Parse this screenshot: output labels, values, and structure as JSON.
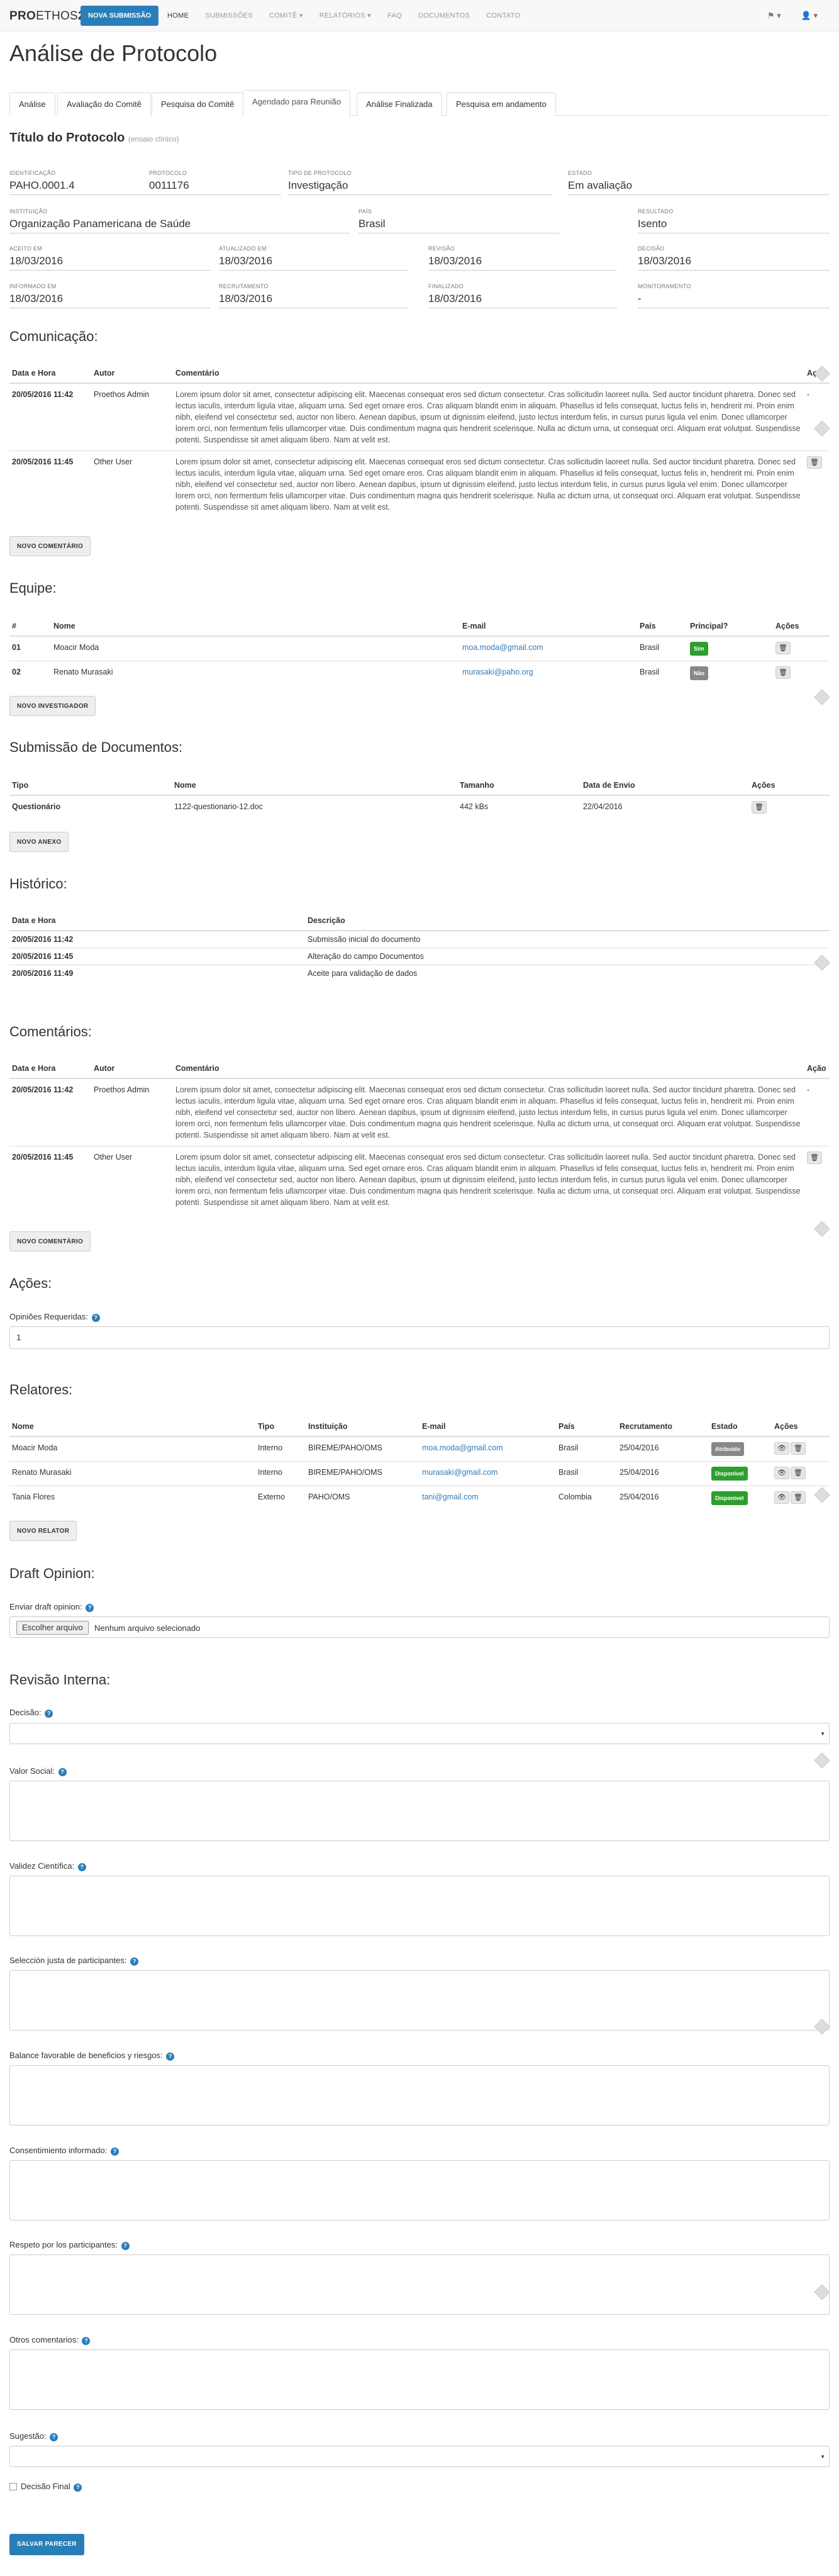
{
  "nav": {
    "brand_a": "PRO",
    "brand_b": "ETHOS",
    "brand_c": "2",
    "new_submission": "NOVA SUBMISSÃO",
    "items": [
      "HOME",
      "SUBMISSÕES",
      "COMITÊ ▾",
      "RELATÓRIOS ▾",
      "FAQ",
      "DOCUMENTOS",
      "CONTATO"
    ],
    "flag": "⚑ ▾",
    "user": "👤 ▾"
  },
  "page_title": "Análise de Protocolo",
  "tabs": [
    "Análise",
    "Avaliação do Comitê",
    "Pesquisa do Comitê",
    "Agendado para Reunião",
    "Análise Finalizada",
    "Pesquisa em andamento"
  ],
  "protocol": {
    "title": "Título do Protocolo",
    "subtitle": "(ensaio clínico)",
    "fields": [
      {
        "label": "IDENTIFICAÇÃO",
        "value": "PAHO.0001.4"
      },
      {
        "label": "PROTOCOLO",
        "value": "0011176"
      },
      {
        "label": "TIPO DE PROTOCOLO",
        "value": "Investigação"
      },
      {
        "label": "ESTADO",
        "value": "Em avaliação"
      },
      {
        "label": "INSTITUIÇÃO",
        "value": "Organização Panamericana de Saúde"
      },
      {
        "label": "PAÍS",
        "value": "Brasil"
      },
      {
        "label": "RESULTADO",
        "value": "Isento"
      },
      {
        "label": "ACEITO EM",
        "value": "18/03/2016"
      },
      {
        "label": "ATUALIZADO EM",
        "value": "18/03/2016"
      },
      {
        "label": "REVISÃO",
        "value": "18/03/2016"
      },
      {
        "label": "DECISÃO",
        "value": "18/03/2016"
      },
      {
        "label": "INFORMADO EM",
        "value": "18/03/2016"
      },
      {
        "label": "RECRUTAMENTO",
        "value": "18/03/2016"
      },
      {
        "label": "FINALIZADO",
        "value": "18/03/2016"
      },
      {
        "label": "MONITORAMENTO",
        "value": "-"
      }
    ]
  },
  "lorem": "Lorem ipsum dolor sit amet, consectetur adipiscing elit. Maecenas consequat eros sed dictum consectetur. Cras sollicitudin laoreet nulla. Sed auctor tincidunt pharetra. Donec sed lectus iaculis, interdum ligula vitae, aliquam urna. Sed eget ornare eros. Cras aliquam blandit enim in aliquam. Phasellus id felis consequat, luctus felis in, hendrerit mi. Proin enim nibh, eleifend vel consectetur sed, auctor non libero. Aenean dapibus, ipsum ut dignissim eleifend, justo lectus interdum felis, in cursus purus ligula vel enim. Donec ullamcorper lorem orci, non fermentum felis ullamcorper vitae. Duis condimentum magna quis hendrerit scelerisque. Nulla ac dictum urna, ut consequat orci. Aliquam erat volutpat. Suspendisse potenti. Suspendisse sit amet aliquam libero. Nam at velit est.",
  "communication": {
    "title": "Comunicação:",
    "headers": [
      "Data e Hora",
      "Autor",
      "Comentário",
      "Ação"
    ],
    "rows": [
      {
        "date": "20/05/2016 11:42",
        "author": "Proethos Admin",
        "action": "-"
      },
      {
        "date": "20/05/2016 11:45",
        "author": "Other User",
        "action": "🗑"
      }
    ],
    "new_button": "NOVO COMENTÁRIO"
  },
  "team": {
    "title": "Equipe:",
    "headers": [
      "#",
      "Nome",
      "E-mail",
      "País",
      "Principal?",
      "Ações"
    ],
    "rows": [
      {
        "n": "01",
        "name": "Moacir Moda",
        "email": "moa.moda@gmail.com",
        "country": "Brasil",
        "principal": "Sim"
      },
      {
        "n": "02",
        "name": "Renato Murasaki",
        "email": "murasaki@paho.org",
        "country": "Brasil",
        "principal": "Não"
      }
    ],
    "new_button": "NOVO INVESTIGADOR"
  },
  "docs": {
    "title": "Submissão de Documentos:",
    "headers": [
      "Tipo",
      "Nome",
      "Tamanho",
      "Data de Envio",
      "Ações"
    ],
    "rows": [
      {
        "type": "Questionário",
        "name": "1122-questionario-12.doc",
        "size": "442 kBs",
        "date": "22/04/2016"
      }
    ],
    "new_button": "NOVO ANEXO"
  },
  "history": {
    "title": "Histórico:",
    "headers": [
      "Data e Hora",
      "Descrição"
    ],
    "rows": [
      {
        "date": "20/05/2016 11:42",
        "desc": "Submissão inicial do documento"
      },
      {
        "date": "20/05/2016 11:45",
        "desc": "Alteração do campo Documentos"
      },
      {
        "date": "20/05/2016 11:49",
        "desc": "Aceite para validação de dados"
      }
    ]
  },
  "comments": {
    "title": "Comentários:",
    "headers": [
      "Data e Hora",
      "Autor",
      "Comentário",
      "Ação"
    ],
    "rows": [
      {
        "date": "20/05/2016 11:42",
        "author": "Proethos Admin",
        "action": "-"
      },
      {
        "date": "20/05/2016 11:45",
        "author": "Other User",
        "action": "🗑"
      }
    ],
    "new_button": "NOVO COMENTÁRIO"
  },
  "actions": {
    "title": "Ações:",
    "label": "Opiniões Requeridas:",
    "value": "1"
  },
  "reporters": {
    "title": "Relatores:",
    "headers": [
      "Nome",
      "Tipo",
      "Instituição",
      "E-mail",
      "País",
      "Recrutamento",
      "Estado",
      "Ações"
    ],
    "rows": [
      {
        "name": "Moacir Moda",
        "type": "Interno",
        "inst": "BIREME/PAHO/OMS",
        "email": "moa.moda@gmail.com",
        "country": "Brasil",
        "date": "25/04/2016",
        "state": "Atribuído",
        "color": "#888"
      },
      {
        "name": "Renato Murasaki",
        "type": "Interno",
        "inst": "BIREME/PAHO/OMS",
        "email": "murasaki@gmail.com",
        "country": "Brasil",
        "date": "25/04/2016",
        "state": "Disponível",
        "color": "#2e9e2e"
      },
      {
        "name": "Tania Flores",
        "type": "Externo",
        "inst": "PAHO/OMS",
        "email": "tani@gmail.com",
        "country": "Colombia",
        "date": "25/04/2016",
        "state": "Disponível",
        "color": "#2e9e2e"
      }
    ],
    "new_button": "NOVO RELATOR"
  },
  "draft": {
    "title": "Draft Opinion:",
    "label": "Enviar draft opinion:",
    "file_button": "Escolher arquivo",
    "file_none": "Nenhum arquivo selecionado"
  },
  "review": {
    "title": "Revisão Interna:",
    "decision": "Decisão:",
    "social": "Valor Social:",
    "validity": "Validez Científica:",
    "selection": "Selección justa de participantes:",
    "balance": "Balance favorable de beneficios y riesgos:",
    "consent": "Consentimiento informado:",
    "respect": "Respeto por los participantes:",
    "other": "Otros comentarios:",
    "suggestion": "Sugestão:",
    "final": "Decisão Final",
    "save": "SALVAR PARECER"
  }
}
